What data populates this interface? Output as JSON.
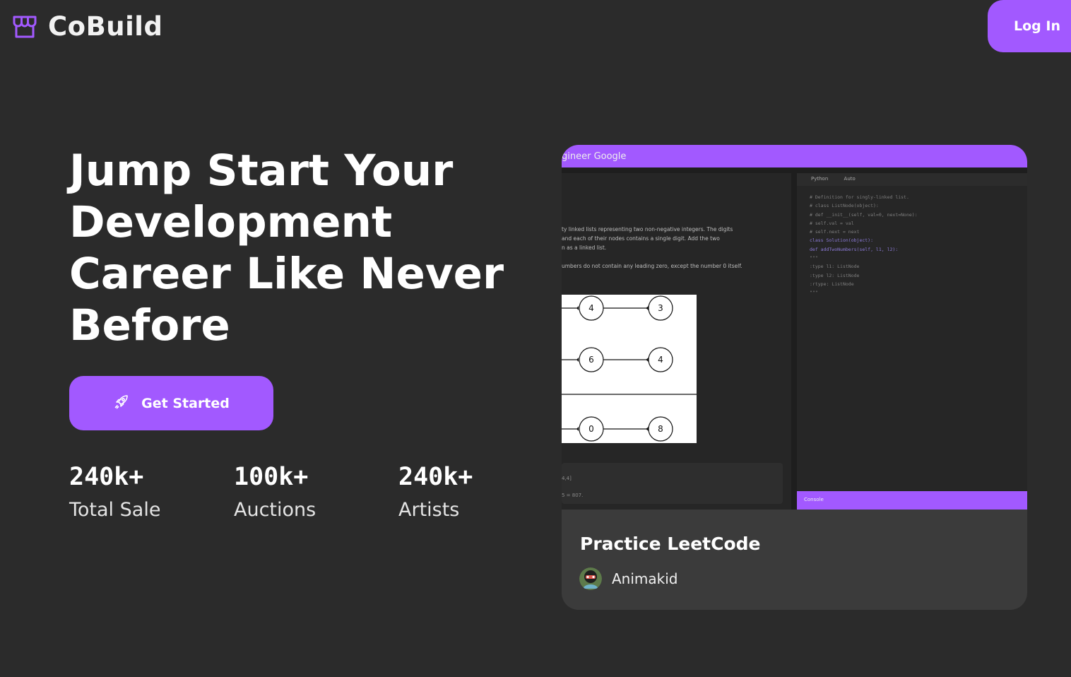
{
  "header": {
    "brand_name": "CoBuild",
    "login_label": "Log In"
  },
  "hero": {
    "title": "Jump Start Your Development Career Like Never Before",
    "cta_label": "Get Started",
    "stats": [
      {
        "value": "240k+",
        "label": "Total Sale"
      },
      {
        "value": "100k+",
        "label": "Auctions"
      },
      {
        "value": "240k+",
        "label": "Artists"
      }
    ]
  },
  "featured": {
    "title": "Practice LeetCode",
    "author": "Animakid",
    "screenshot": {
      "tab_title": "gineer Google",
      "language": "Python",
      "mode": "Auto",
      "problem_lines": [
        "ty linked lists representing two non-negative integers. The digits",
        "and each of their nodes contains a single digit. Add the two",
        "n as a linked list.",
        "",
        "umbers do not contain any leading zero, except the number 0 itself."
      ],
      "code_lines": [
        "# Definition for singly-linked list.",
        "# class ListNode(object):",
        "#   def __init__(self, val=0, next=None):",
        "#     self.val = val",
        "#     self.next = next",
        "class Solution(object):",
        "    def addTwoNumbers(self, l1, l2):",
        "        \"\"\"",
        "        :type l1: ListNode",
        "        :type l2: ListNode",
        "        :rtype: ListNode",
        "        \"\"\""
      ],
      "nodes_row1": [
        "4",
        "3"
      ],
      "nodes_row2": [
        "6",
        "4"
      ],
      "nodes_row3": [
        "0",
        "8"
      ],
      "io_lines": [
        "4,4]",
        "5 = 807."
      ],
      "console_label": "Console"
    }
  },
  "colors": {
    "accent": "#a259ff",
    "background": "#2b2b2b",
    "card": "#3b3b3b"
  }
}
